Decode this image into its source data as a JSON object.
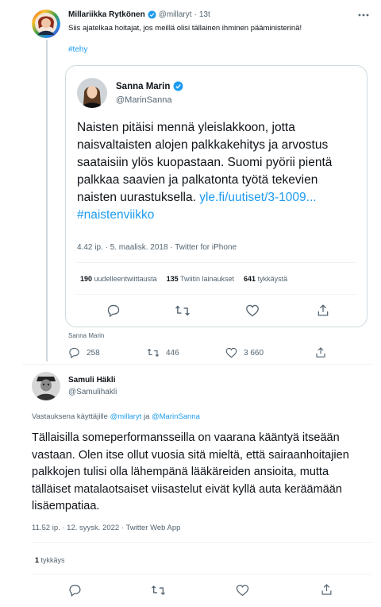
{
  "tweet1": {
    "author_name": "Millariikka Rytkönen",
    "handle": "@millaryt",
    "separator": "·",
    "time": "13t",
    "text": "Siis ajatelkaa hoitajat, jos meillä olisi tällainen ihminen pääministerinä!",
    "hashtag": "#tehy",
    "more_icon": "ellipsis-icon",
    "quote": {
      "author_name": "Sanna Marin",
      "handle": "@MarinSanna",
      "text": "Naisten pitäisi mennä yleislakkoon, jotta naisvaltaisten alojen palkkakehitys ja arvostus saataisiin ylös kuopastaan. Suomi pyörii pientä palkkaa saavien ja palkatonta työtä tekevien naisten uurastuksella.",
      "link1": "yle.fi/uutiset/3-1009...",
      "link2": "#naistenviikko",
      "timestamp": "4.42 ip. · 5. maalisk. 2018 · Twitter for iPhone",
      "stats": {
        "retweets_count": "190",
        "retweets_label": "uudelleentwiittausta",
        "quotes_count": "135",
        "quotes_label": "Twiitin lainaukset",
        "likes_count": "641",
        "likes_label": "tykkäystä"
      }
    },
    "attribution": "Sanna Marin",
    "replies": "258",
    "retweets": "446",
    "likes": "3 660"
  },
  "tweet2": {
    "author_name": "Samuli Häkli",
    "handle": "@Samulihakli",
    "replying_prefix": "Vastauksena käyttäjille",
    "replying_user1": "@millaryt",
    "replying_join": "ja",
    "replying_user2": "@MarinSanna",
    "text": "Tällaisilla someperformansseilla on vaarana kääntyä itseään vastaan. Olen itse ollut vuosia sitä mieltä, että sairaanhoitajien palkkojen tulisi olla lähempänä lääkäreiden ansioita, mutta tälläiset matalaotsaiset viisastelut eivät kyllä auta keräämään lisäempatiaa.",
    "timestamp": "11.52 ip. · 12. syysk. 2022 · Twitter Web App",
    "likes_count": "1",
    "likes_label": "tykkäys"
  },
  "colors": {
    "accent": "#1d9bf0",
    "text": "#0f1419",
    "muted": "#536471",
    "border": "#cfd9de"
  }
}
